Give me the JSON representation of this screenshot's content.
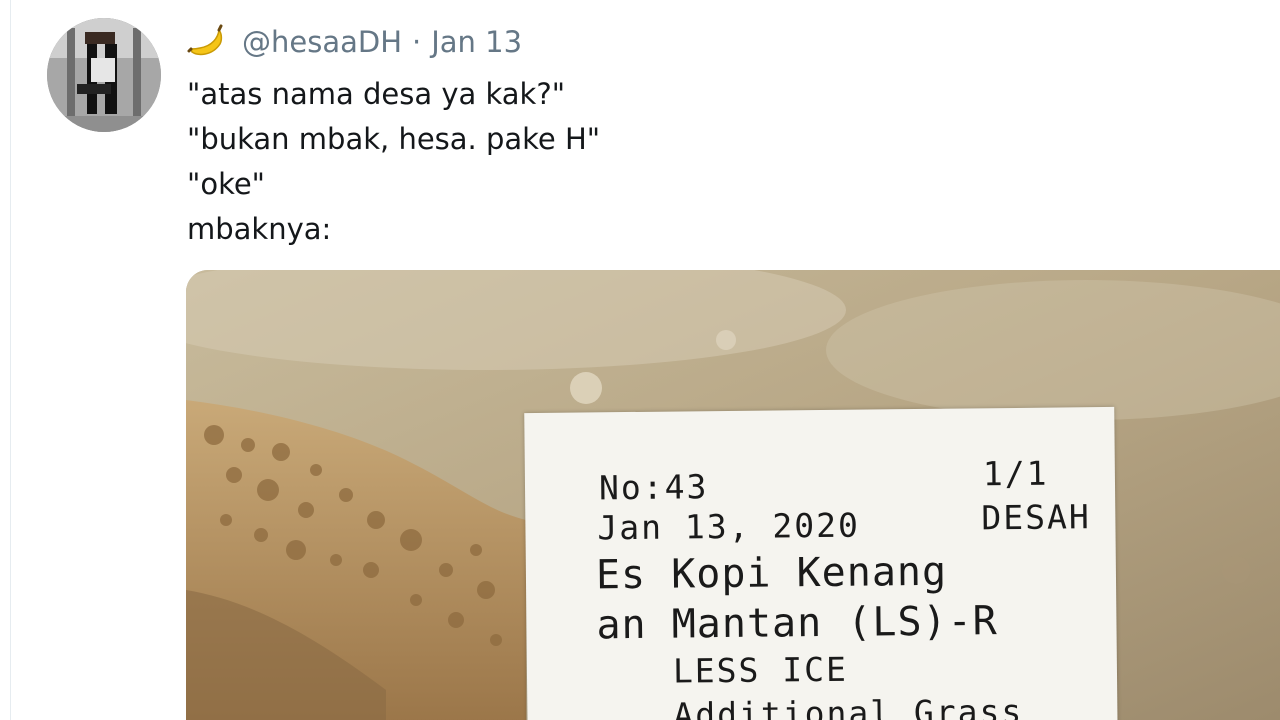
{
  "tweet": {
    "icon": "banana-icon",
    "handle": "@hesaaDH",
    "separator": "·",
    "date": "Jan 13",
    "lines": [
      "\"atas nama desa ya kak?\"",
      "\"bukan mbak, hesa. pake H\"",
      "\"oke\"",
      "mbaknya:"
    ]
  },
  "receipt": {
    "order_no": "No:43",
    "page": "1/1",
    "date": "Jan 13, 2020",
    "name": "DESAH",
    "item_line1": "Es Kopi Kenang",
    "item_line2": "an Mantan (LS)-R",
    "mod1": "LESS ICE",
    "mod2": "Additional Grass"
  },
  "colors": {
    "text": "#14171a",
    "secondary": "#657786",
    "banana": "#f5c518"
  }
}
